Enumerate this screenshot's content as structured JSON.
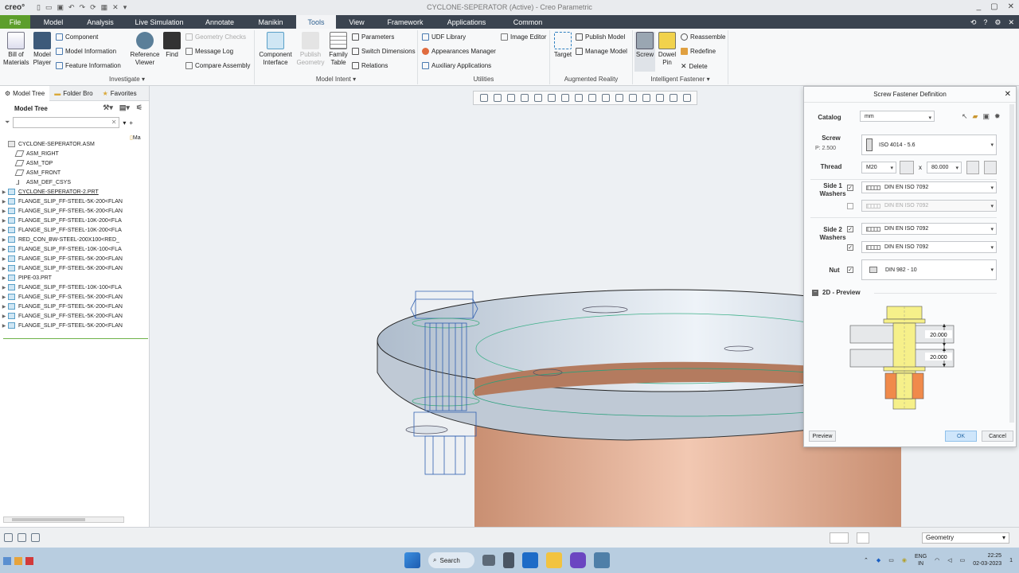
{
  "titlebar": {
    "logo": "creo°",
    "title": "CYCLONE-SEPERATOR (Active) - Creo Parametric",
    "controls": [
      "?",
      "⚙",
      "_",
      "▢",
      "✕"
    ]
  },
  "menubar": {
    "tabs": [
      "File",
      "Model",
      "Analysis",
      "Live Simulation",
      "Annotate",
      "Manikin",
      "Tools",
      "View",
      "Framework",
      "Applications",
      "Common"
    ],
    "active": "Tools",
    "right": [
      "⟲",
      "?",
      "⚙",
      "✕"
    ]
  },
  "ribbon": {
    "investigate": {
      "label": "Investigate ▾",
      "bill_of_materials": "Bill of Materials",
      "model_player": "Model Player",
      "component": "Component",
      "model_information": "Model Information",
      "feature_information": "Feature Information",
      "reference_viewer": "Reference Viewer",
      "find": "Find",
      "geometry_checks": "Geometry Checks",
      "message_log": "Message Log",
      "compare_assembly": "Compare Assembly"
    },
    "model_intent": {
      "label": "Model Intent ▾",
      "component_interface": "Component Interface",
      "publish_geometry": "Publish Geometry",
      "family_table": "Family Table",
      "parameters": "Parameters",
      "switch_dimensions": "Switch Dimensions",
      "relations": "Relations"
    },
    "utilities": {
      "label": "Utilities",
      "udf_library": "UDF Library",
      "appearances_manager": "Appearances Manager",
      "auxiliary_applications": "Auxiliary Applications",
      "image_editor": "Image Editor"
    },
    "augmented_reality": {
      "label": "Augmented Reality",
      "target": "Target",
      "publish_model": "Publish Model",
      "manage_model": "Manage Model"
    },
    "intelligent_fastener": {
      "label": "Intelligent Fastener ▾",
      "screw": "Screw",
      "dowel_pin": "Dowel Pin",
      "reassemble": "Reassemble",
      "redefine": "Redefine",
      "delete": "Delete"
    }
  },
  "leftpanel": {
    "tabs": [
      "Model Tree",
      "Folder Bro",
      "Favorites"
    ],
    "header": "Model Tree",
    "search_placeholder": "",
    "column_hint": "Ma",
    "items": [
      {
        "label": "CYCLONE-SEPERATOR.ASM",
        "type": "asm",
        "expandable": false
      },
      {
        "label": "ASM_RIGHT",
        "type": "plane",
        "expandable": false
      },
      {
        "label": "ASM_TOP",
        "type": "plane",
        "expandable": false
      },
      {
        "label": "ASM_FRONT",
        "type": "plane",
        "expandable": false
      },
      {
        "label": "ASM_DEF_CSYS",
        "type": "csys",
        "expandable": false
      },
      {
        "label": "CYCLONE-SEPERATOR-2.PRT",
        "type": "part",
        "expandable": true
      },
      {
        "label": "FLANGE_SLIP_FF-STEEL-5K-200<FLAN",
        "type": "part",
        "expandable": true
      },
      {
        "label": "FLANGE_SLIP_FF-STEEL-5K-200<FLAN",
        "type": "part",
        "expandable": true
      },
      {
        "label": "FLANGE_SLIP_FF-STEEL-10K-200<FLA",
        "type": "part",
        "expandable": true
      },
      {
        "label": "FLANGE_SLIP_FF-STEEL-10K-200<FLA",
        "type": "part",
        "expandable": true
      },
      {
        "label": "RED_CON_BW-STEEL-200X100<RED_",
        "type": "part",
        "expandable": true
      },
      {
        "label": "FLANGE_SLIP_FF-STEEL-10K-100<FLA",
        "type": "part",
        "expandable": true
      },
      {
        "label": "FLANGE_SLIP_FF-STEEL-5K-200<FLAN",
        "type": "part",
        "expandable": true
      },
      {
        "label": "FLANGE_SLIP_FF-STEEL-5K-200<FLAN",
        "type": "part",
        "expandable": true
      },
      {
        "label": "PIPE-03.PRT",
        "type": "part",
        "expandable": true
      },
      {
        "label": "FLANGE_SLIP_FF-STEEL-10K-100<FLA",
        "type": "part",
        "expandable": true
      },
      {
        "label": "FLANGE_SLIP_FF-STEEL-5K-200<FLAN",
        "type": "part",
        "expandable": true
      },
      {
        "label": "FLANGE_SLIP_FF-STEEL-5K-200<FLAN",
        "type": "part",
        "expandable": true
      },
      {
        "label": "FLANGE_SLIP_FF-STEEL-5K-200<FLAN",
        "type": "part",
        "expandable": true
      },
      {
        "label": "FLANGE_SLIP_FF-STEEL-5K-200<FLAN",
        "type": "part",
        "expandable": true
      }
    ]
  },
  "dialog": {
    "title": "Screw Fastener Definition",
    "catalog_label": "Catalog",
    "catalog_value": "mm",
    "screw_label": "Screw",
    "screw_pitch": "P: 2.500",
    "screw_value": "ISO 4014 - 5.6",
    "thread_label": "Thread",
    "thread_size": "M20",
    "thread_x": "x",
    "thread_length": "80.000",
    "side1_label": "Side 1 Washers",
    "side1_washer1": "DIN EN ISO 7092",
    "side1_washer2": "DIN EN ISO 7092",
    "side2_label": "Side 2 Washers",
    "side2_washer1": "DIN EN ISO 7092",
    "side2_washer2": "DIN EN ISO 7092",
    "nut_label": "Nut",
    "nut_value": "DIN 982 - 10",
    "preview_section": "2D - Preview",
    "dim_top": "20.000",
    "dim_bottom": "20.000",
    "preview_button": "Preview",
    "ok_button": "OK",
    "cancel_button": "Cancel"
  },
  "statusbar": {
    "filter": "Geometry"
  },
  "taskbar": {
    "search": "Search",
    "lang_top": "ENG",
    "lang_bottom": "IN",
    "time": "22:25",
    "date": "02-03-2023",
    "notification": "1"
  },
  "colors": {
    "menubar": "#3b4450",
    "file_tab": "#5d9e2b",
    "flange_steel": "#c8d3df",
    "pipe_copper": "#d9a58b",
    "bolt_wire": "#2f5fb0",
    "preview_screw": "#f6f08a",
    "preview_nut": "#f08a4b",
    "ok_button": "#cfe6fb"
  }
}
